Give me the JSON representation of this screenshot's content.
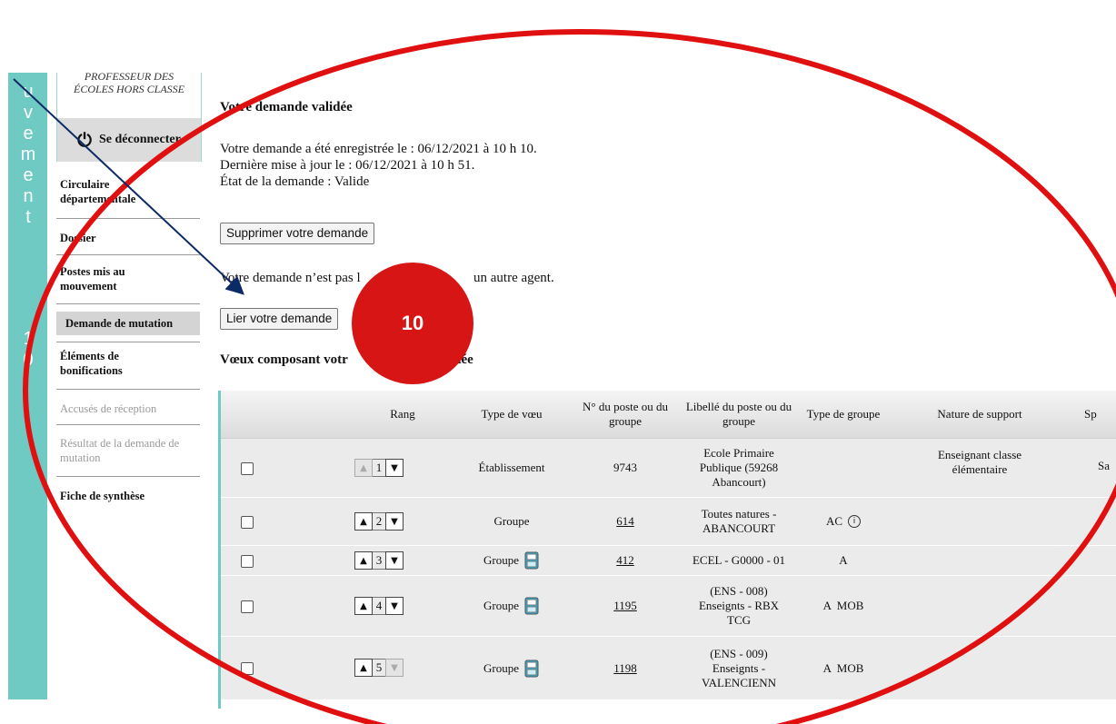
{
  "sidebar_strip": {
    "letters": [
      "u",
      "v",
      "e",
      "m",
      "e",
      "n",
      "t",
      "1",
      "0"
    ]
  },
  "card": {
    "role": "ÉCOLES HORS CLASSE",
    "role_top": "PROFESSEUR DES",
    "logout_label": "Se déconnecter"
  },
  "menu": {
    "items": [
      {
        "label": "Circulaire départementale"
      },
      {
        "label": "Dossier"
      },
      {
        "label": "Postes mis au mouvement"
      },
      {
        "label": "Demande de mutation"
      },
      {
        "label": "Éléments de bonifications"
      },
      {
        "label": "Accusés de réception"
      },
      {
        "label": "Résultat de la demande de mutation"
      },
      {
        "label": "Fiche de synthèse"
      }
    ]
  },
  "main": {
    "title": "Votre demande validée",
    "registered": "Votre demande a été enregistrée le : 06/12/2021 à 10 h 10.",
    "updated": "Dernière mise à jour le : 06/12/2021 à 10 h 51.",
    "state": "État de la demande : Valide",
    "delete_button": "Supprimer votre demande",
    "link_text_start": "Votre demande n’est pas l",
    "link_text_end": "un autre agent.",
    "link_button": "Lier votre demande",
    "voeux_heading_start": "Vœux composant votr",
    "voeux_heading_end": "idée"
  },
  "table": {
    "headers": [
      "Rang",
      "Type de vœu",
      "N° du poste ou du groupe",
      "Libellé du poste ou du groupe",
      "Type de groupe",
      "Nature de support",
      "Sp"
    ],
    "rows": [
      {
        "rank": "1",
        "type": "Établissement",
        "num": "9743",
        "libelle": "Ecole Primaire Publique (59268 Abancourt)",
        "groupe": "",
        "nature": "Enseignant classe élémentaire",
        "sp": "Sa"
      },
      {
        "rank": "2",
        "type": "Groupe",
        "num": "614",
        "libelle": "Toutes natures - ABANCOURT",
        "groupe": "AC",
        "nature": "",
        "sp": ""
      },
      {
        "rank": "3",
        "type": "Groupe",
        "num": "412",
        "libelle": "ECEL - G0000 - 01",
        "groupe": "A",
        "nature": "",
        "sp": ""
      },
      {
        "rank": "4",
        "type": "Groupe",
        "num": "1195",
        "libelle": "(ENS - 008) Enseignts - RBX TCG",
        "groupe": "A  MOB",
        "nature": "",
        "sp": ""
      },
      {
        "rank": "5",
        "type": "Groupe",
        "num": "1198",
        "libelle": "(ENS - 009) Enseignts - VALENCIENN",
        "groupe": "A  MOB",
        "nature": "",
        "sp": ""
      }
    ]
  },
  "annotation": {
    "badge_number": "10",
    "colors": {
      "badge": "#d81515",
      "ellipse": "#e01010",
      "arrow": "#0c2a66",
      "teal": "#6fcac4"
    }
  }
}
